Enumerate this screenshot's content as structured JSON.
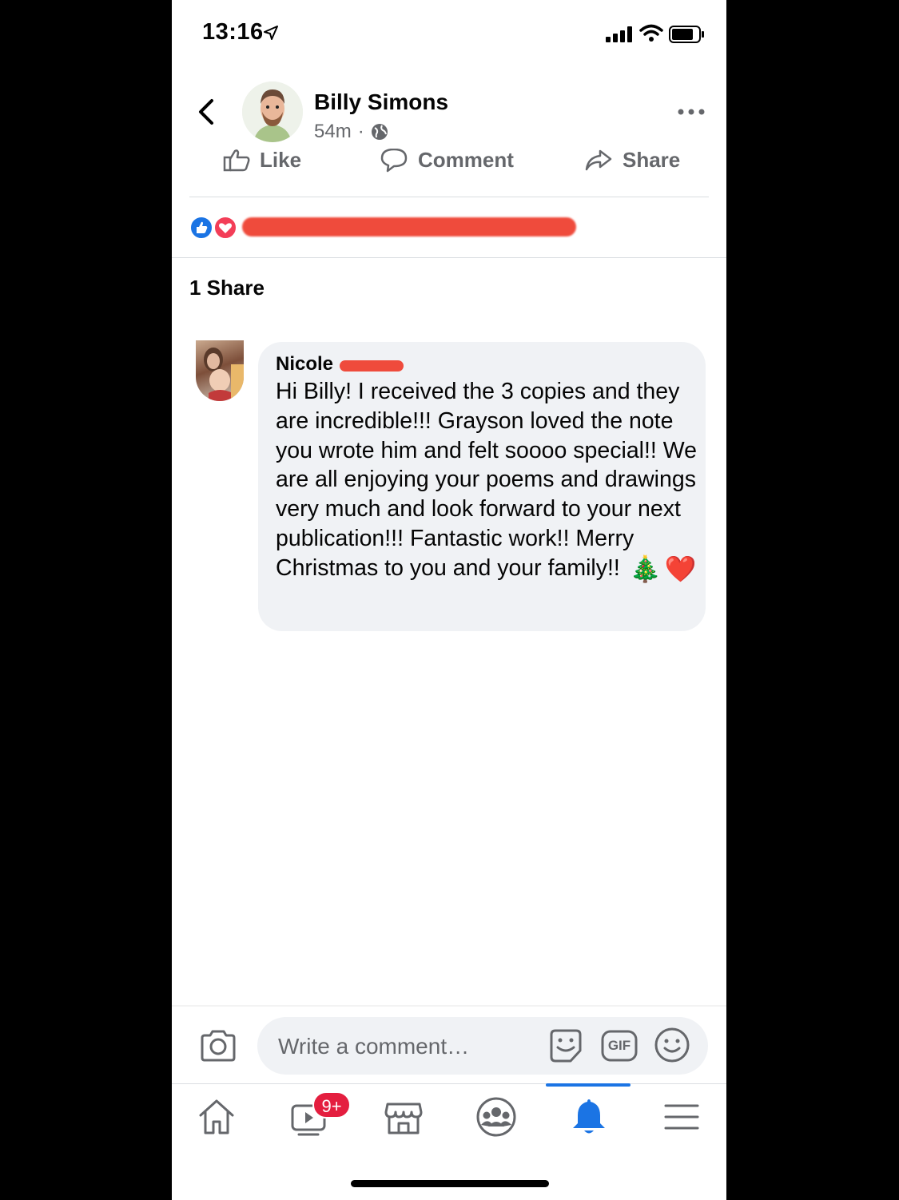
{
  "status_bar": {
    "time": "13:16"
  },
  "post": {
    "author": "Billy Simons",
    "time_ago": "54m",
    "meta_separator": "·"
  },
  "actions": {
    "like": "Like",
    "comment": "Comment",
    "share": "Share"
  },
  "shares": {
    "label": "1 Share"
  },
  "comment": {
    "author_first": "Nicole",
    "text": "Hi Billy! I received the 3 copies and they are incredible!!! Grayson loved the note you wrote him and felt soooo special!! We are all enjoying your poems and drawings very much and look forward to your next publication!!! Fantastic work!! Merry Christmas to you and your family!!",
    "emoji_tree": "🎄",
    "emoji_heart": "❤️"
  },
  "composer": {
    "placeholder": "Write a comment…",
    "gif_label": "GIF"
  },
  "tabbar": {
    "watch_badge": "9+"
  },
  "colors": {
    "accent": "#1b74e4",
    "badge": "#e41e3f",
    "redaction": "#ef4b3c",
    "bubble": "#f0f2f5"
  },
  "icons": [
    "back-arrow-icon",
    "globe-icon",
    "more-icon",
    "like-icon",
    "comment-icon",
    "share-icon",
    "camera-icon",
    "sticker-icon",
    "gif-icon",
    "emoji-icon",
    "home-icon",
    "watch-icon",
    "marketplace-icon",
    "groups-icon",
    "bell-icon",
    "menu-icon"
  ]
}
